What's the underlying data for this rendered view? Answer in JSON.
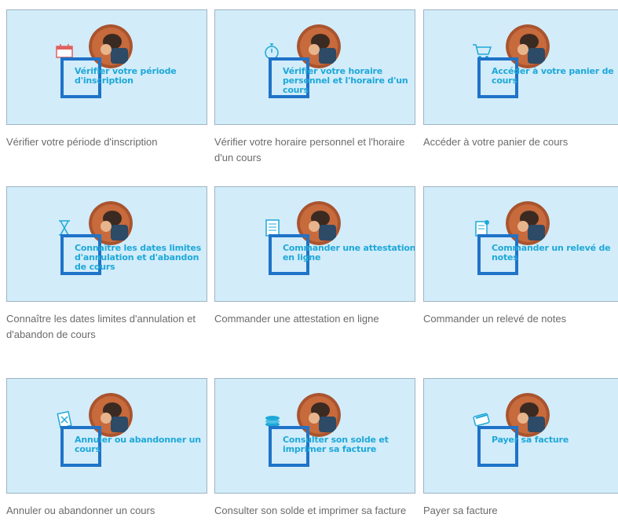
{
  "cards": [
    {
      "thumb_text": "Vérifier votre période d'inscription",
      "caption": "Vérifier votre période d'inscription",
      "icon": "calendar-icon"
    },
    {
      "thumb_text": "Vérifier votre horaire personnel et l'horaire d'un cours",
      "caption": "Vérifier votre horaire personnel et l'horaire d'un cours",
      "icon": "stopwatch-icon"
    },
    {
      "thumb_text": "Accéder à votre panier de cours",
      "caption": "Accéder à votre panier de cours",
      "icon": "shopping-cart-icon"
    },
    {
      "thumb_text": "Connaître les dates limites d'annulation et d'abandon de cours",
      "caption": "Connaître les dates limites d'annulation et d'abandon de cours",
      "icon": "hourglass-icon"
    },
    {
      "thumb_text": "Commander une attestation en ligne",
      "caption": "Commander une attestation en ligne",
      "icon": "document-icon"
    },
    {
      "thumb_text": "Commander un relevé de notes",
      "caption": "Commander un relevé de notes",
      "icon": "transcript-icon"
    },
    {
      "thumb_text": "Annuler ou abandonner un cours",
      "caption": "Annuler ou abandonner un cours",
      "icon": "cancel-document-icon"
    },
    {
      "thumb_text": "Consulter son solde et imprimer sa facture",
      "caption": "Consulter son solde et imprimer sa facture",
      "icon": "money-icon"
    },
    {
      "thumb_text": "Payer sa facture",
      "caption": "Payer sa facture",
      "icon": "payment-icon"
    }
  ],
  "colors": {
    "thumb_background": "#d2ecfa",
    "frame_blue": "#1f73c8",
    "thumb_text_blue": "#1ea8d8",
    "caption_gray": "#6a6a6a"
  }
}
